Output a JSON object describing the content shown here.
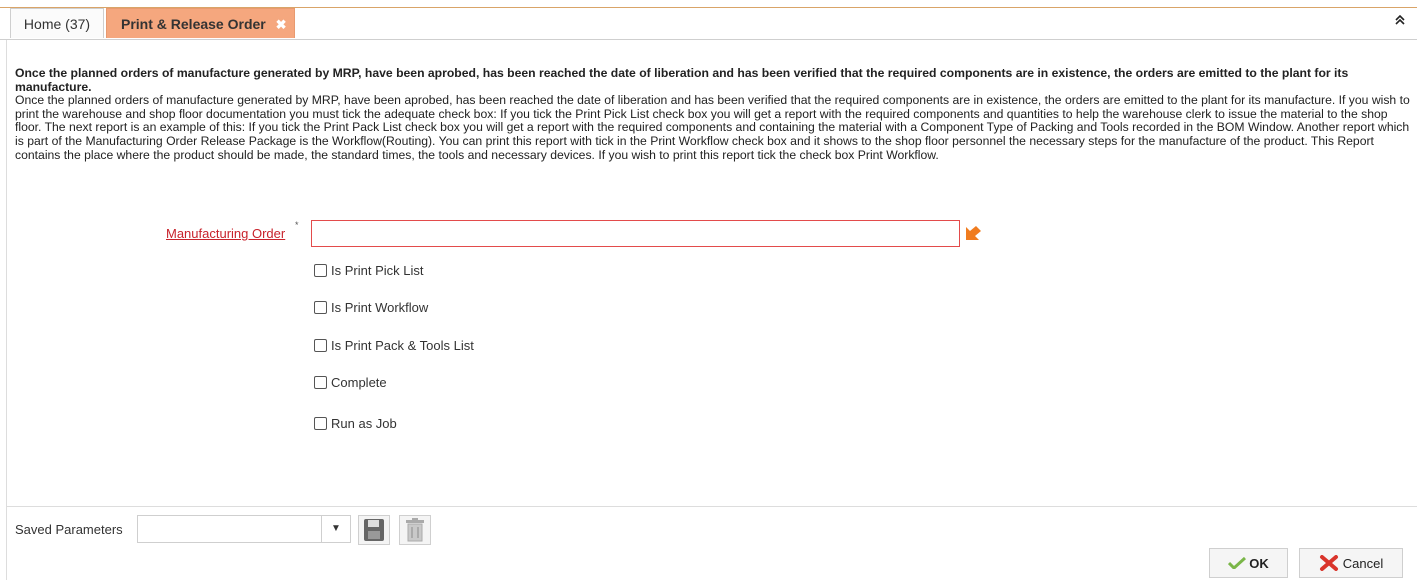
{
  "tabs": {
    "home_label": "Home (37)",
    "active_label": "Print & Release Order",
    "close_glyph": "✖",
    "collapse_glyph": "«"
  },
  "description": {
    "title": "Once the planned orders of manufacture generated by MRP, have been aprobed, has been reached the date of liberation and has been verified that the required components are in existence, the orders are emitted to the plant for its manufacture.",
    "body": "Once the planned orders of manufacture generated by MRP, have been aprobed, has been reached the date of liberation and has been verified that the required components are in existence, the orders are emitted to the plant for its manufacture. If you wish to print the warehouse and shop floor documentation you must tick the adequate check box: If you tick the Print Pick List check box you will get a report with the required components and quantities to help the warehouse clerk to issue the material to the shop floor. The next report is an example of this: If you tick the Print Pack List check box you will get a report with the required components and containing the material with a Component Type of Packing and Tools recorded in the BOM Window. Another report which is part of the Manufacturing Order Release Package is the Workflow(Routing). You can print this report with tick in the Print Workflow check box and it shows to the shop floor personnel the necessary steps for the manufacture of the product. This Report contains the place where the product should be made, the standard times, the tools and necessary devices. If you wish to print this report tick the check box Print Workflow."
  },
  "form": {
    "manufacturing_order_label": "Manufacturing Order",
    "required_marker": "*",
    "manufacturing_order_value": "",
    "checkboxes": [
      {
        "label": "Is Print Pick List",
        "checked": false
      },
      {
        "label": "Is Print Workflow",
        "checked": false
      },
      {
        "label": "Is Print Pack & Tools List",
        "checked": false
      },
      {
        "label": "Complete",
        "checked": false
      },
      {
        "label": "Run as Job",
        "checked": false
      }
    ]
  },
  "footer": {
    "saved_parameters_label": "Saved Parameters",
    "saved_parameters_value": "",
    "ok_label": "OK",
    "cancel_label": "Cancel"
  },
  "icons": {
    "zoom": "zoom-arrow-icon",
    "save": "save-disk-icon",
    "delete": "trash-icon",
    "ok": "checkmark-icon",
    "cancel": "red-x-icon"
  },
  "colors": {
    "active_tab": "#f5a77e",
    "required_label": "#c8232c",
    "input_border_required": "#e34b4b",
    "zoom_icon": "#f07c1f",
    "ok_check": "#7ab648",
    "cancel_x": "#d9342b"
  }
}
